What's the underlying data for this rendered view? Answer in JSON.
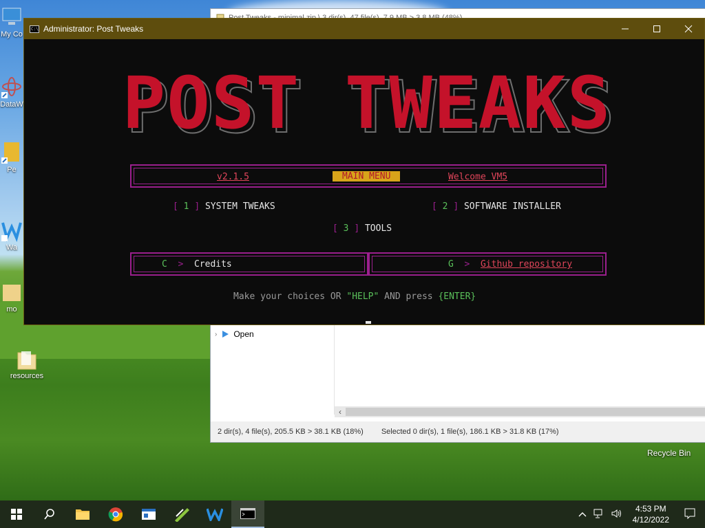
{
  "desktop": {
    "icons": [
      {
        "label": "My Co"
      },
      {
        "label": "DataW"
      },
      {
        "label": "Pe"
      },
      {
        "label": "Wa"
      },
      {
        "label": "mo"
      },
      {
        "label": "resources"
      }
    ],
    "recycle_bin": "Recycle Bin"
  },
  "explorer": {
    "title": "Post Tweaks - minimal.zip \\ 3 dir(s), 47 file(s), 7.9 MB > 3.8 MB (48%)",
    "tree_open": "Open",
    "status_left": "2 dir(s), 4 file(s), 205.5 KB > 38.1 KB (18%)",
    "status_right": "Selected 0 dir(s), 1 file(s), 186.1 KB > 31.8 KB (17%)"
  },
  "console": {
    "title": "Administrator:  Post Tweaks",
    "banner": "POST TWEAKS",
    "version": "v2.1.5",
    "main_menu": "MAIN MENU",
    "welcome": "Welcome VM5",
    "options": [
      {
        "key": "1",
        "label": "SYSTEM TWEAKS"
      },
      {
        "key": "2",
        "label": "SOFTWARE INSTALLER"
      },
      {
        "key": "3",
        "label": "TOOLS"
      }
    ],
    "credits_key": "C",
    "credits_label": "Credits",
    "github_key": "G",
    "github_label": "Github repository",
    "prompt_a": "Make your choices OR ",
    "prompt_help": "\"HELP\"",
    "prompt_b": " AND press ",
    "prompt_enter": "{ENTER}",
    "bracket_open": "[",
    "bracket_close": "]",
    "arrow": ">"
  },
  "taskbar": {
    "time": "4:53 PM",
    "date": "4/12/2022"
  },
  "colors": {
    "banner_red": "#c4122a",
    "border_purple": "#9b1f8e",
    "menu_highlight": "#d8a41a",
    "key_green": "#5ac05a",
    "title_bar": "#5e4d0d"
  }
}
